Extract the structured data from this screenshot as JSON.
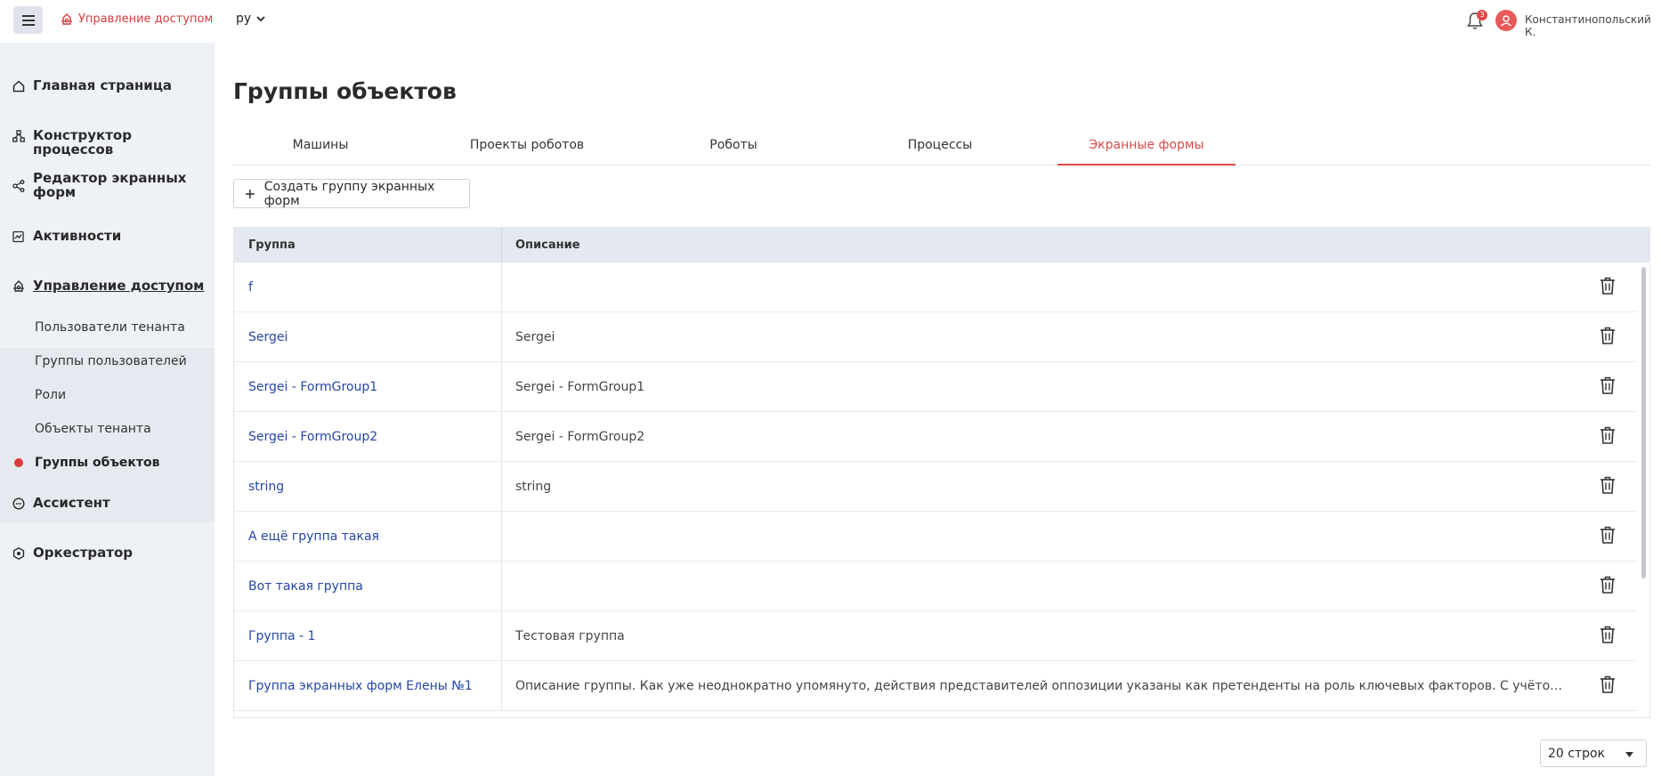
{
  "topbar": {
    "menu_icon": "hamburger-icon",
    "brand_label": "Управление доступом",
    "language": "ру",
    "notifications_count": "3",
    "user_name": "Константинопольский К."
  },
  "sidebar": {
    "items": [
      {
        "label": "Главная страница",
        "icon": "home-icon"
      },
      {
        "label": "Конструктор процессов",
        "icon": "process-icon"
      },
      {
        "label": "Редактор экранных форм",
        "icon": "form-editor-icon"
      },
      {
        "label": "Активности",
        "icon": "activity-icon"
      },
      {
        "label": "Управление доступом",
        "icon": "access-icon"
      },
      {
        "label": "Ассистент",
        "icon": "assistant-icon"
      },
      {
        "label": "Оркестратор",
        "icon": "orchestrator-icon"
      }
    ],
    "subitems": [
      {
        "label": "Пользователи тенанта"
      },
      {
        "label": "Группы пользователей"
      },
      {
        "label": "Роли"
      },
      {
        "label": "Объекты тенанта"
      },
      {
        "label": "Группы объектов"
      }
    ]
  },
  "main": {
    "title": "Группы объектов",
    "tabs": [
      {
        "label": "Машины"
      },
      {
        "label": "Проекты роботов"
      },
      {
        "label": "Роботы"
      },
      {
        "label": "Процессы"
      },
      {
        "label": "Экранные формы"
      }
    ],
    "create_button": "Создать группу экранных форм",
    "table": {
      "headers": {
        "group": "Группа",
        "description": "Описание"
      },
      "rows": [
        {
          "group": "f",
          "description": ""
        },
        {
          "group": "Sergei",
          "description": "Sergei"
        },
        {
          "group": "Sergei - FormGroup1",
          "description": "Sergei - FormGroup1"
        },
        {
          "group": "Sergei - FormGroup2",
          "description": "Sergei - FormGroup2"
        },
        {
          "group": "string",
          "description": "string"
        },
        {
          "group": "А ещё группа такая",
          "description": ""
        },
        {
          "group": "Вот такая группа",
          "description": ""
        },
        {
          "group": "Группа - 1",
          "description": "Тестовая группа"
        },
        {
          "group": "Группа экранных форм Елены №1",
          "description": "Описание группы. Как уже неоднократно упомянуто, действия представителей оппозиции указаны как претенденты на роль ключевых факторов. С учётом сложившейся международной обстановки"
        }
      ]
    },
    "rows_per_page": "20 строк"
  },
  "colors": {
    "accent": "#e04848",
    "link": "#2446a6",
    "sidebar_bg": "#eef1f6",
    "header_bg": "#e4e8f0"
  }
}
